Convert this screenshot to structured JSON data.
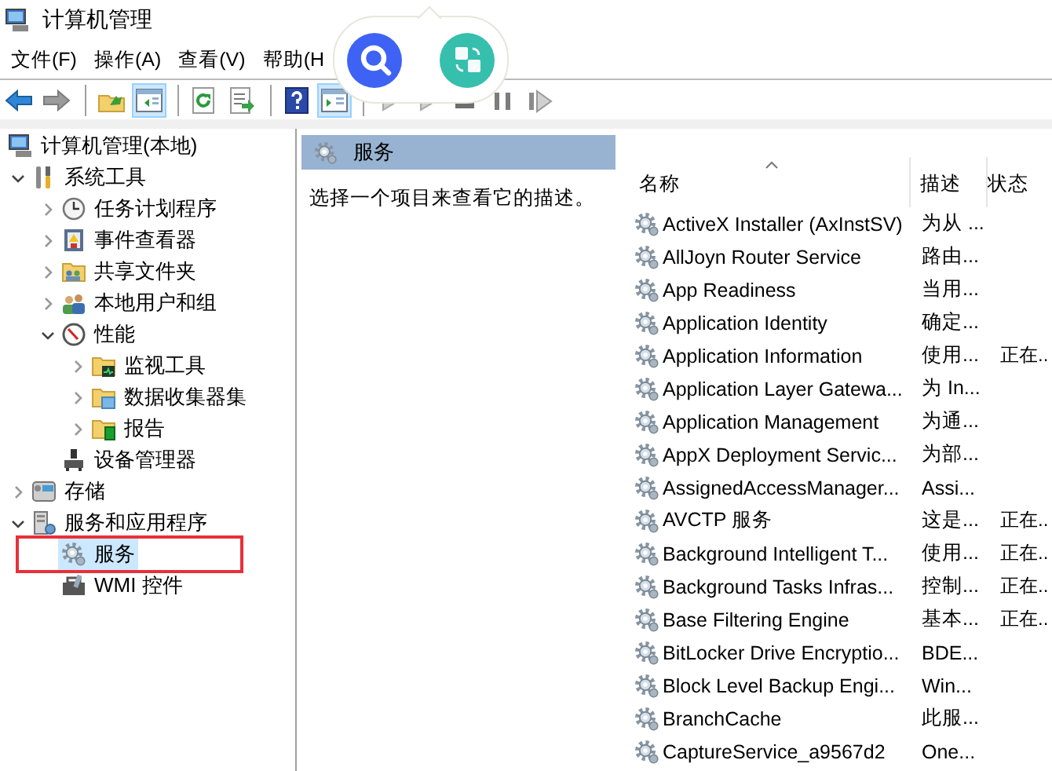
{
  "window": {
    "title": "计算机管理"
  },
  "menu": [
    {
      "label": "文件(F)"
    },
    {
      "label": "操作(A)"
    },
    {
      "label": "查看(V)"
    },
    {
      "label": "帮助(H"
    }
  ],
  "toolbar": [
    {
      "kind": "back",
      "disabled": false
    },
    {
      "kind": "forward",
      "disabled": true
    },
    {
      "kind": "separator"
    },
    {
      "kind": "up",
      "disabled": false
    },
    {
      "kind": "tree-pane",
      "disabled": false,
      "on": true
    },
    {
      "kind": "separator"
    },
    {
      "kind": "refresh",
      "disabled": false
    },
    {
      "kind": "export",
      "disabled": false
    },
    {
      "kind": "separator"
    },
    {
      "kind": "help",
      "disabled": false
    },
    {
      "kind": "action-pane",
      "disabled": false,
      "on": true
    },
    {
      "kind": "separator"
    },
    {
      "kind": "start",
      "disabled": true
    },
    {
      "kind": "start",
      "disabled": true
    },
    {
      "kind": "stop",
      "disabled": true
    },
    {
      "kind": "pause",
      "disabled": true
    },
    {
      "kind": "resume",
      "disabled": true
    }
  ],
  "popup": {
    "buttons": [
      {
        "kind": "search"
      },
      {
        "kind": "translate"
      }
    ]
  },
  "tree": [
    {
      "label": "计算机管理(本地)",
      "kind": "computer",
      "selected": false,
      "children": [
        {
          "label": "系统工具",
          "kind": "tools",
          "selected": false,
          "expanded": true,
          "children": [
            {
              "label": "任务计划程序",
              "kind": "clock",
              "selected": false,
              "expanded": false
            },
            {
              "label": "事件查看器",
              "kind": "log",
              "selected": false,
              "expanded": false
            },
            {
              "label": "共享文件夹",
              "kind": "shared",
              "selected": false,
              "expanded": false
            },
            {
              "label": "本地用户和组",
              "kind": "users",
              "selected": false,
              "expanded": false
            },
            {
              "label": "性能",
              "kind": "gauge",
              "selected": false,
              "expanded": true,
              "children": [
                {
                  "label": "监视工具",
                  "kind": "folder-monitor",
                  "selected": false,
                  "expanded": false
                },
                {
                  "label": "数据收集器集",
                  "kind": "folder-data",
                  "selected": false,
                  "expanded": false
                },
                {
                  "label": "报告",
                  "kind": "folder-report",
                  "selected": false,
                  "expanded": false
                }
              ]
            },
            {
              "label": "设备管理器",
              "kind": "device",
              "selected": false
            }
          ]
        },
        {
          "label": "存储",
          "kind": "storage",
          "selected": false,
          "expanded": false
        },
        {
          "label": "服务和应用程序",
          "kind": "server",
          "selected": false,
          "expanded": true,
          "children": [
            {
              "label": "服务",
              "kind": "services",
              "selected": true
            },
            {
              "label": "WMI 控件",
              "kind": "wmi",
              "selected": false
            }
          ]
        }
      ]
    }
  ],
  "panel": {
    "title": "服务",
    "description": "选择一个项目来查看它的描述。"
  },
  "table": {
    "columns": [
      {
        "label": "名称",
        "sorted": true
      },
      {
        "label": "描述",
        "sorted": false
      },
      {
        "label": "状态",
        "sorted": false
      }
    ],
    "rows": [
      {
        "name": "ActiveX Installer (AxInstSV)",
        "description": "为从 ...",
        "status": ""
      },
      {
        "name": "AllJoyn Router Service",
        "description": "路由...",
        "status": ""
      },
      {
        "name": "App Readiness",
        "description": "当用...",
        "status": ""
      },
      {
        "name": "Application Identity",
        "description": "确定...",
        "status": ""
      },
      {
        "name": "Application Information",
        "description": "使用...",
        "status": "正在.."
      },
      {
        "name": "Application Layer Gatewa...",
        "description": "为 In...",
        "status": ""
      },
      {
        "name": "Application Management",
        "description": "为通...",
        "status": ""
      },
      {
        "name": "AppX Deployment Servic...",
        "description": "为部...",
        "status": ""
      },
      {
        "name": "AssignedAccessManager...",
        "description": "Assi...",
        "status": ""
      },
      {
        "name": "AVCTP 服务",
        "description": "这是...",
        "status": "正在.."
      },
      {
        "name": "Background Intelligent T...",
        "description": "使用...",
        "status": "正在.."
      },
      {
        "name": "Background Tasks Infras...",
        "description": "控制...",
        "status": "正在.."
      },
      {
        "name": "Base Filtering Engine",
        "description": "基本...",
        "status": "正在.."
      },
      {
        "name": "BitLocker Drive Encryptio...",
        "description": "BDE...",
        "status": ""
      },
      {
        "name": "Block Level Backup Engi...",
        "description": "Win...",
        "status": ""
      },
      {
        "name": "BranchCache",
        "description": "此服...",
        "status": ""
      },
      {
        "name": "CaptureService_a9567d2",
        "description": "One...",
        "status": ""
      }
    ]
  }
}
